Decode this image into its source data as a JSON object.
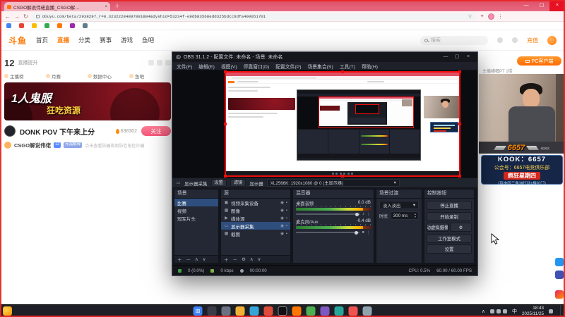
{
  "icons": {
    "close": "×",
    "minimize": "—",
    "maximize": "▢",
    "plus": "＋",
    "back": "←",
    "forward": "→",
    "refresh": "↻",
    "star": "☆",
    "extension": "✦",
    "menu": "⋮",
    "obs_logo": "◎",
    "gear": "⚙",
    "eye": "◉",
    "lock": "▪",
    "dropdown": "▾",
    "add": "＋",
    "remove": "－",
    "up": "∧",
    "down": "∨",
    "speaker": "♪",
    "mic": "●",
    "more": "⋮",
    "spin_up": "▴",
    "spin_down": "▾",
    "win": "⊞"
  },
  "colors": {
    "douyu_orange": "#ff7700",
    "follow_button": "#f5587b",
    "capture_border": "#f20d0d",
    "obs_selection": "#2e4e7e",
    "kook_panel": "#152647",
    "slogan_red": "#d3271c"
  },
  "browser": {
    "tab_title": "CSGO解说伟佬直播_CSGO解…",
    "url": "douyu.com/beta/2938297_r=0.32322284897891884&dyshid=53234f-e9db83568edd325bdcc6dfa400051701"
  },
  "douyu": {
    "logo": "斗鱼",
    "nav": [
      "首页",
      "直播",
      "分类",
      "赛事",
      "游戏",
      "鱼吧"
    ],
    "search_placeholder": "搜索",
    "recharge": "充值",
    "level": {
      "value": "12",
      "label": "直播提升",
      "tabs": [
        "主播榜",
        "月赛",
        "数据中心",
        "鱼吧"
      ]
    },
    "banner": {
      "line1": "1人鬼服",
      "line2": "狂吃资源"
    },
    "stream": {
      "title": "DONK POV 下午来上分",
      "heat": "638302",
      "follow": "关注",
      "channel": "CSGO解说伟佬",
      "badge_level": "12",
      "badge_fan": "无需解释",
      "notice": "点击查看防骗指南防范电信诈骗"
    }
  },
  "overlay": {
    "pc_client": "PC客户端",
    "cam_note": "主播横幅PT 1楼",
    "logo": "6657",
    "deco": "«««",
    "kook": "KOOK：6657",
    "guild": "公会号：6657电竞俱乐部",
    "slogan": "疯狂星期四",
    "slogan_sub": "（有肉四三角洲行动1楼拉门）"
  },
  "obs": {
    "title": "OBS 31.1.2 - 配置文件: 未命名 - 场景: 未命名",
    "menu": [
      "文件(F)",
      "编辑(E)",
      "视图(V)",
      "停靠窗口(D)",
      "配置文件(P)",
      "场景集合(S)",
      "工具(T)",
      "帮助(H)"
    ],
    "toolbar": {
      "source": "显示器采集",
      "settings": "设置",
      "filters": "滤镜",
      "monitor_label": "显示器",
      "monitor_value": "XL2566K: 1920x1080 @ 0 (主显示器)"
    },
    "scenes": {
      "title": "场景",
      "items": [
        "比赛",
        "视频",
        "冠军片头"
      ]
    },
    "sources": {
      "title": "源",
      "items": [
        {
          "name": "视频采集设备",
          "icon": "▣"
        },
        {
          "name": "图像",
          "icon": "▦"
        },
        {
          "name": "媒体源",
          "icon": "▶"
        },
        {
          "name": "显示器采集",
          "icon": "▭"
        },
        {
          "name": "截图",
          "icon": "▦"
        }
      ]
    },
    "mixer": {
      "title": "混音器",
      "tracks": [
        {
          "name": "桌面音频",
          "db": "0.0 dB"
        },
        {
          "name": "麦克风/Aux",
          "db": "-0.4 dB"
        }
      ]
    },
    "transitions": {
      "title": "场景过渡",
      "value": "淡入淡出",
      "duration_label": "时长",
      "duration": "300 ms"
    },
    "controls": {
      "title": "控制按钮",
      "b1": "停止直播",
      "b2": "开始录制",
      "b3": "启动虚拟摄像机",
      "b4": "工作室模式",
      "b5": "设置"
    },
    "status": {
      "dropped": "0 (0.0%)",
      "bitrate": "0 kbps",
      "time": "00:00:00",
      "cpu": "CPU: 0.5%",
      "fps": "60.00 / 60.00 FPS"
    }
  },
  "taskbar": {
    "input": "中",
    "time": "18:43",
    "date": "2025/11/25"
  }
}
